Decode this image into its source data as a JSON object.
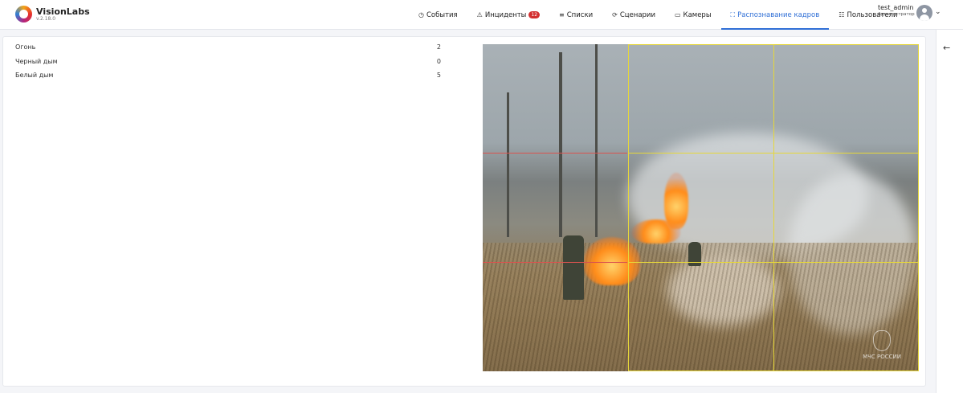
{
  "app": {
    "name": "VisionLabs",
    "version": "v.2.18.0"
  },
  "nav": [
    {
      "icon": "clock-icon",
      "glyph": "◷",
      "label": "События",
      "active": false
    },
    {
      "icon": "warning-icon",
      "glyph": "⚠",
      "label": "Инциденты",
      "badge": "12",
      "active": false
    },
    {
      "icon": "list-icon",
      "glyph": "≡",
      "label": "Списки",
      "active": false
    },
    {
      "icon": "scenario-icon",
      "glyph": "⟳",
      "label": "Сценарии",
      "active": false
    },
    {
      "icon": "camera-icon",
      "glyph": "▭",
      "label": "Камеры",
      "active": false
    },
    {
      "icon": "frame-icon",
      "glyph": "⛶",
      "label": "Распознавание кадров",
      "active": true
    },
    {
      "icon": "users-icon",
      "glyph": "☷",
      "label": "Пользователи",
      "active": false
    }
  ],
  "user": {
    "name": "test_admin",
    "role": "Администратор"
  },
  "stats": [
    {
      "label": "Огонь",
      "value": "2"
    },
    {
      "label": "Черный дым",
      "value": "0"
    },
    {
      "label": "Белый дым",
      "value": "5"
    }
  ],
  "image": {
    "watermark": "МЧС РОССИИ"
  },
  "colors": {
    "accent": "#2f6fd6",
    "badge": "#d32f2f",
    "grid": "#e6d73a"
  }
}
